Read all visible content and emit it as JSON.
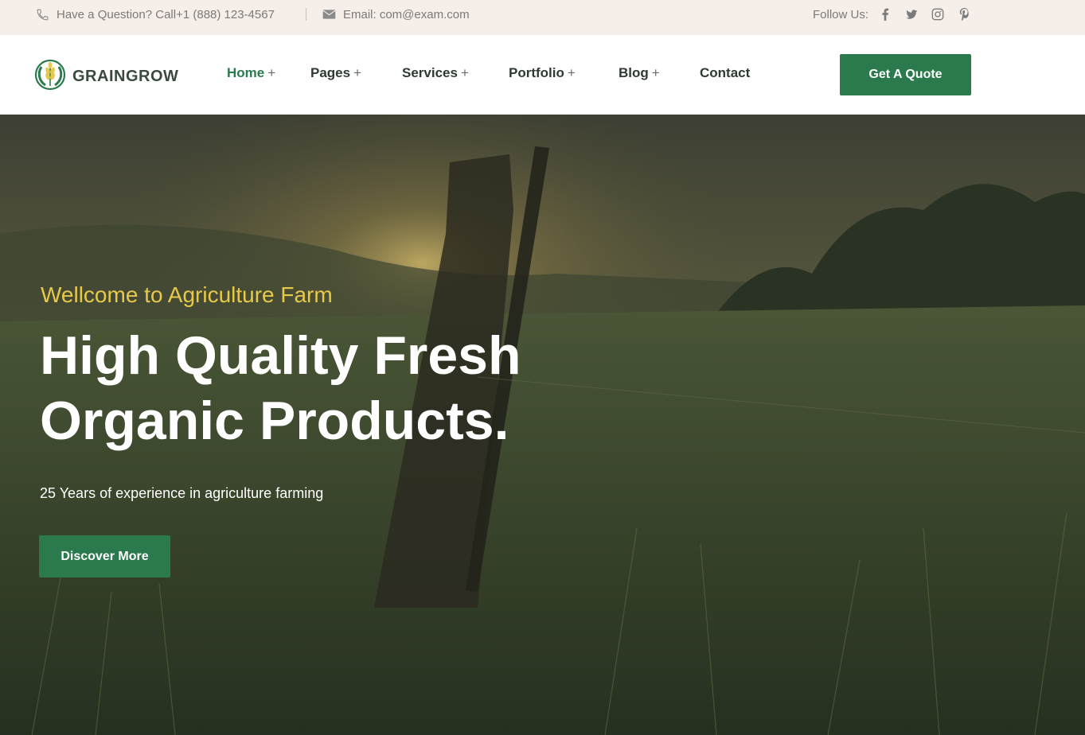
{
  "topbar": {
    "phone_text": "Have a Question? Call+1 (888) 123-4567",
    "email_text": "Email: com@exam.com",
    "follow_label": "Follow Us:",
    "socials": [
      "facebook-icon",
      "twitter-icon",
      "instagram-icon",
      "pinterest-icon"
    ]
  },
  "header": {
    "brand": "GRAINGROW",
    "nav": [
      {
        "label": "Home",
        "plus": "+",
        "active": true
      },
      {
        "label": "Pages",
        "plus": "+"
      },
      {
        "label": "Services",
        "plus": "+"
      },
      {
        "label": "Portfolio",
        "plus": "+"
      },
      {
        "label": "Blog",
        "plus": "+"
      },
      {
        "label": "Contact",
        "plus": ""
      }
    ],
    "cta": "Get A Quote"
  },
  "hero": {
    "welcome": "Wellcome to Agriculture Farm",
    "headline_line1": "High Quality Fresh",
    "headline_line2": "Organic Products.",
    "subtitle": "25 Years of experience in agriculture farming",
    "button": "Discover More"
  },
  "colors": {
    "brand_green": "#2a7a4e",
    "accent_yellow": "#e7c94a",
    "topbar_bg": "#f6eee8"
  }
}
